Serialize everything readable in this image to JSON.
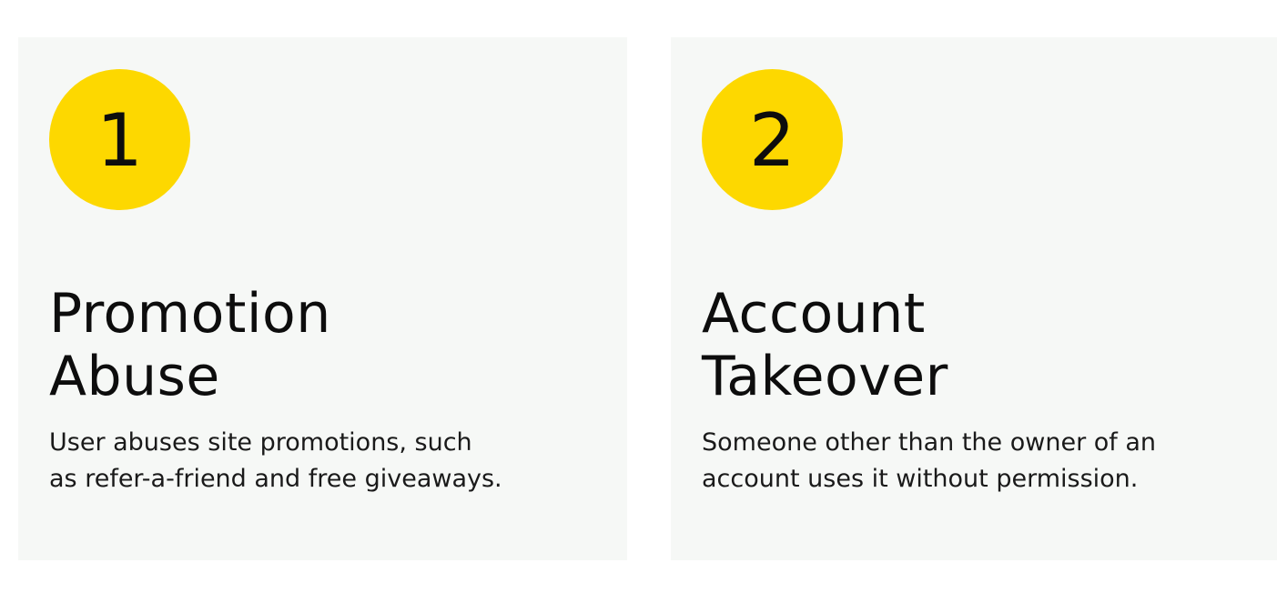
{
  "cards": [
    {
      "number": "1",
      "title_lines": [
        "Promotion",
        "Abuse"
      ],
      "description_lines": [
        "User abuses site promotions, such",
        "as refer-a-friend and free giveaways."
      ]
    },
    {
      "number": "2",
      "title_lines": [
        "Account",
        "Takeover"
      ],
      "description_lines": [
        "Someone other than the owner of an",
        "account uses it without permission."
      ]
    }
  ],
  "colors": {
    "badge": "#fdd800",
    "card_background": "#f6f8f6",
    "text": "#0d0d0d"
  }
}
